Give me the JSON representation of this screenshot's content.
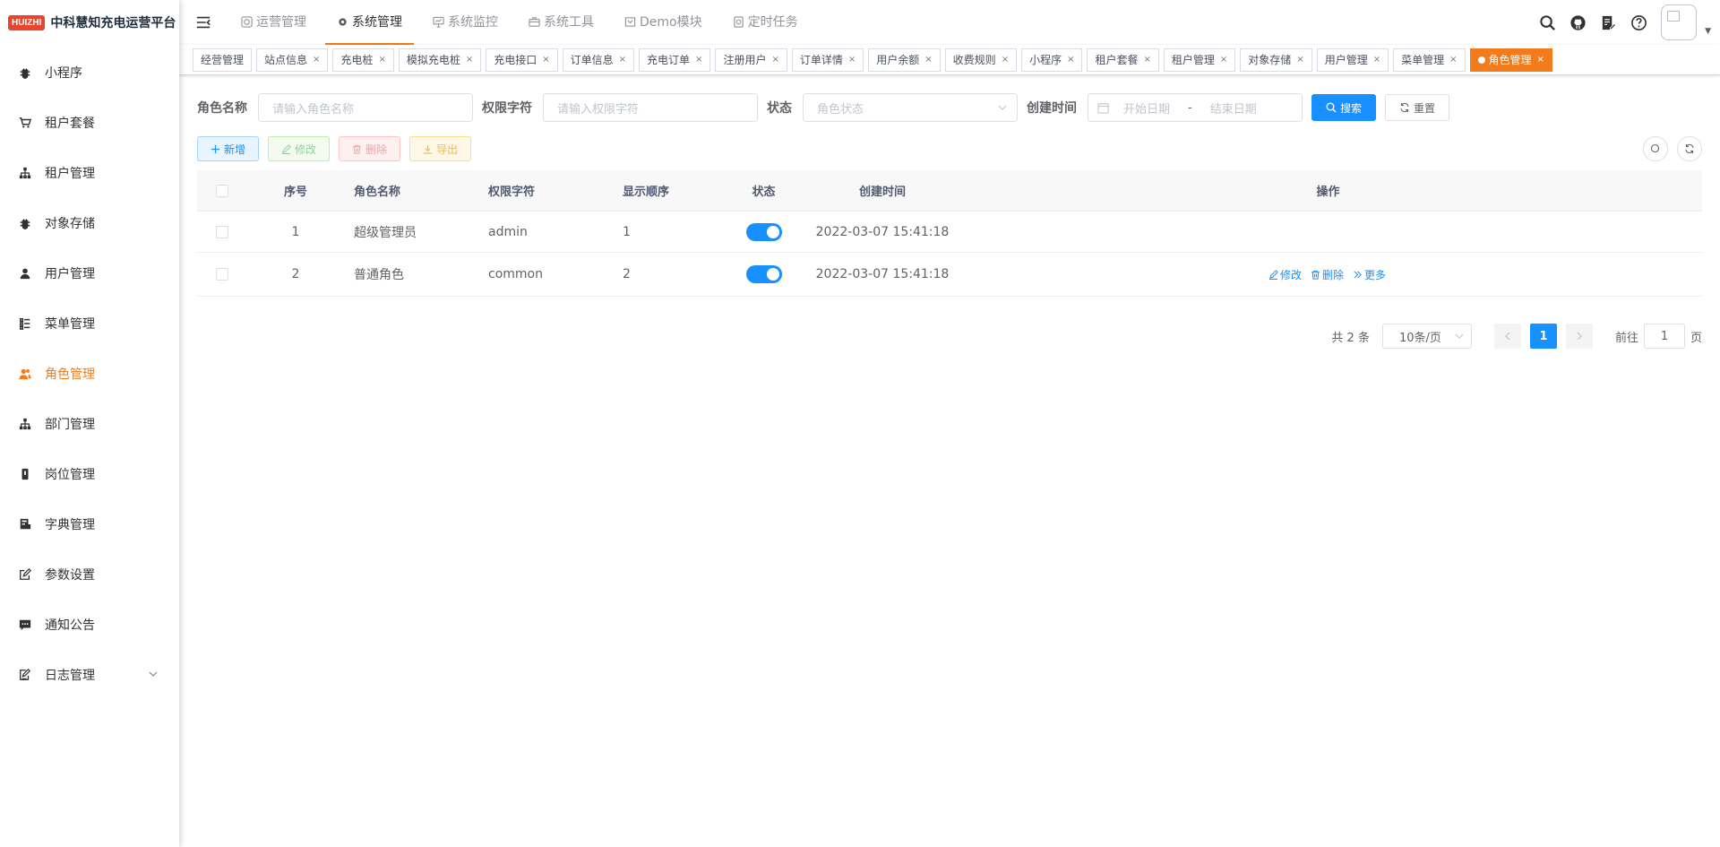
{
  "logo": {
    "badge": "HUIZHI",
    "title": "中科慧知充电运营平台"
  },
  "sidebar": {
    "items": [
      {
        "label": "小程序",
        "icon": "bug-icon"
      },
      {
        "label": "租户套餐",
        "icon": "shopping-cart-icon"
      },
      {
        "label": "租户管理",
        "icon": "tree-icon"
      },
      {
        "label": "对象存储",
        "icon": "bug-icon"
      },
      {
        "label": "用户管理",
        "icon": "user-icon"
      },
      {
        "label": "菜单管理",
        "icon": "tree-table-icon"
      },
      {
        "label": "角色管理",
        "icon": "peoples-icon"
      },
      {
        "label": "部门管理",
        "icon": "tree-icon"
      },
      {
        "label": "岗位管理",
        "icon": "post-icon"
      },
      {
        "label": "字典管理",
        "icon": "dict-icon"
      },
      {
        "label": "参数设置",
        "icon": "edit-icon"
      },
      {
        "label": "通知公告",
        "icon": "message-icon"
      },
      {
        "label": "日志管理",
        "icon": "log-icon"
      }
    ],
    "active": "角色管理",
    "active_color": "#f27c1b"
  },
  "topmenu": {
    "items": [
      "运营管理",
      "系统管理",
      "系统监控",
      "系统工具",
      "Demo模块",
      "定时任务"
    ],
    "active": "系统管理"
  },
  "tags": {
    "items": [
      "经营管理",
      "站点信息",
      "充电桩",
      "模拟充电桩",
      "充电接口",
      "订单信息",
      "充电订单",
      "注册用户",
      "订单详情",
      "用户余额",
      "收费规则",
      "小程序",
      "租户套餐",
      "租户管理",
      "对象存储",
      "用户管理",
      "菜单管理",
      "角色管理"
    ],
    "active": "角色管理",
    "close": "×"
  },
  "search": {
    "role_name_label": "角色名称",
    "role_name_placeholder": "请输入角色名称",
    "role_key_label": "权限字符",
    "role_key_placeholder": "请输入权限字符",
    "status_label": "状态",
    "status_placeholder": "角色状态",
    "time_label": "创建时间",
    "start_placeholder": "开始日期",
    "range_sep": "-",
    "end_placeholder": "结束日期",
    "search_btn": "搜索",
    "reset_btn": "重置"
  },
  "toolbar": {
    "add": "新增",
    "edit": "修改",
    "delete": "删除",
    "export": "导出"
  },
  "table": {
    "columns": [
      "序号",
      "角色名称",
      "权限字符",
      "显示顺序",
      "状态",
      "创建时间",
      "操作"
    ],
    "rows": [
      {
        "no": "1",
        "name": "超级管理员",
        "key": "admin",
        "sort": "1",
        "status_on": true,
        "time": "2022-03-07 15:41:18",
        "ops": []
      },
      {
        "no": "2",
        "name": "普通角色",
        "key": "common",
        "sort": "2",
        "status_on": true,
        "time": "2022-03-07 15:41:18",
        "ops": [
          "修改",
          "删除",
          "更多"
        ]
      }
    ]
  },
  "pagination": {
    "total": "共 2 条",
    "page_size": "10条/页",
    "current": "1",
    "goto_label": "前往",
    "goto_value": "1",
    "page_unit": "页"
  },
  "colors": {
    "primary": "#1890ff",
    "accent": "#f27c1b"
  }
}
